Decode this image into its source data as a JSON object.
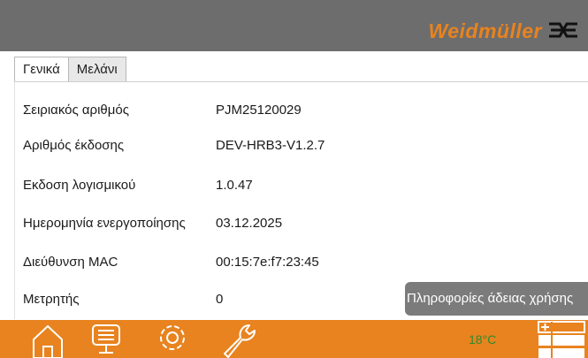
{
  "header": {
    "brand": "Weidmüller",
    "brand_icon": "weidmuller-logo-icon",
    "background": "#6d6d6d",
    "accent": "#e8831f"
  },
  "tabs": [
    {
      "label": "Γενικά",
      "active": true
    },
    {
      "label": "Μελάνι",
      "active": false
    }
  ],
  "info_rows": [
    {
      "label": "Σειριακός αριθμός",
      "value": "PJM25120029"
    },
    {
      "label": "Αριθμός έκδοσης",
      "value": "DEV-HRB3-V1.2.7"
    },
    {
      "label": "Εκδοση λογισμικού",
      "value": "1.0.47"
    },
    {
      "label": "Ημερομηνία ενεργοποίησης",
      "value": "03.12.2025"
    },
    {
      "label": "Διεύθυνση MAC",
      "value": "00:15:7e:f7:23:45"
    },
    {
      "label": "Μετρητής",
      "value": "0"
    }
  ],
  "license_button": {
    "label": "Πληροφορίες άδειας χρήσης"
  },
  "footer": {
    "icons": [
      "home-icon",
      "monitor-icon",
      "settings-icon",
      "wrench-icon",
      "job-list-icon"
    ],
    "temperature": "18°C",
    "background": "#e8831f",
    "temperature_color": "#2e8b2e"
  }
}
